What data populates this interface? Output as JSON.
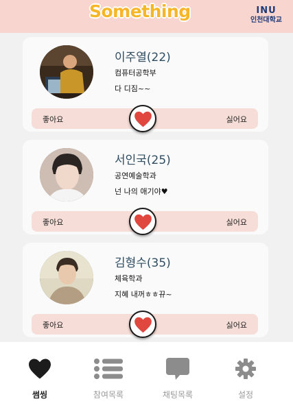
{
  "header": {
    "logo": "Something",
    "university_mark": "INU",
    "university_name": "인천대학교"
  },
  "colors": {
    "header_bg": "#f8d6cf",
    "logo": "#f7b528",
    "heart": "#e0473e",
    "bar_bg": "#f6ddd8",
    "name_text": "#2e4d63"
  },
  "profiles": [
    {
      "name": "이주열(22)",
      "department": "컴퓨터공학부",
      "status": "다 디짐~~",
      "like_label": "좋아요",
      "dislike_label": "싫어요"
    },
    {
      "name": "서인국(25)",
      "department": "공연예술학과",
      "status": "넌 나의 애기야♥",
      "like_label": "좋아요",
      "dislike_label": "싫어요"
    },
    {
      "name": "김형수(35)",
      "department": "체육학과",
      "status": "지혜 내꺼ㅎㅎ뀨~",
      "like_label": "좋아요",
      "dislike_label": "싫어요"
    }
  ],
  "tabs": [
    {
      "label": "썸씽",
      "icon": "heart-icon",
      "active": true
    },
    {
      "label": "참여목록",
      "icon": "list-icon",
      "active": false
    },
    {
      "label": "채팅목록",
      "icon": "chat-bubble-icon",
      "active": false
    },
    {
      "label": "설정",
      "icon": "gear-icon",
      "active": false
    }
  ]
}
